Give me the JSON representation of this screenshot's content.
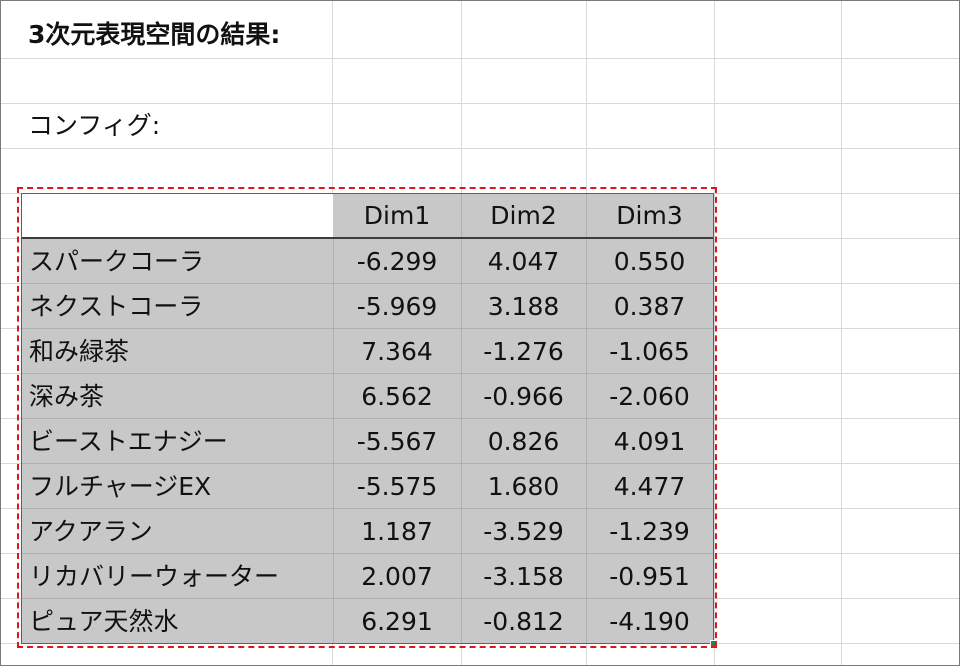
{
  "sheet": {
    "title": "3次元表現空間の結果:",
    "config_label": "コンフィグ:"
  },
  "table": {
    "columns": [
      "Dim1",
      "Dim2",
      "Dim3"
    ],
    "rows": [
      {
        "label": "スパークコーラ",
        "values": [
          "-6.299",
          "4.047",
          "0.550"
        ]
      },
      {
        "label": "ネクストコーラ",
        "values": [
          "-5.969",
          "3.188",
          "0.387"
        ]
      },
      {
        "label": "和み緑茶",
        "values": [
          "7.364",
          "-1.276",
          "-1.065"
        ]
      },
      {
        "label": "深み茶",
        "values": [
          "6.562",
          "-0.966",
          "-2.060"
        ]
      },
      {
        "label": "ビーストエナジー",
        "values": [
          "-5.567",
          "0.826",
          "4.091"
        ]
      },
      {
        "label": "フルチャージEX",
        "values": [
          "-5.575",
          "1.680",
          "4.477"
        ]
      },
      {
        "label": "アクアラン",
        "values": [
          "1.187",
          "-3.529",
          "-1.239"
        ]
      },
      {
        "label": "リカバリーウォーター",
        "values": [
          "2.007",
          "-3.158",
          "-0.951"
        ]
      },
      {
        "label": "ピュア天然水",
        "values": [
          "6.291",
          "-0.812",
          "-4.190"
        ]
      }
    ]
  },
  "colors": {
    "table_fill": "#c8c8c8",
    "selection_dash": "#e0161b",
    "selection_border": "#2e7d4f"
  }
}
